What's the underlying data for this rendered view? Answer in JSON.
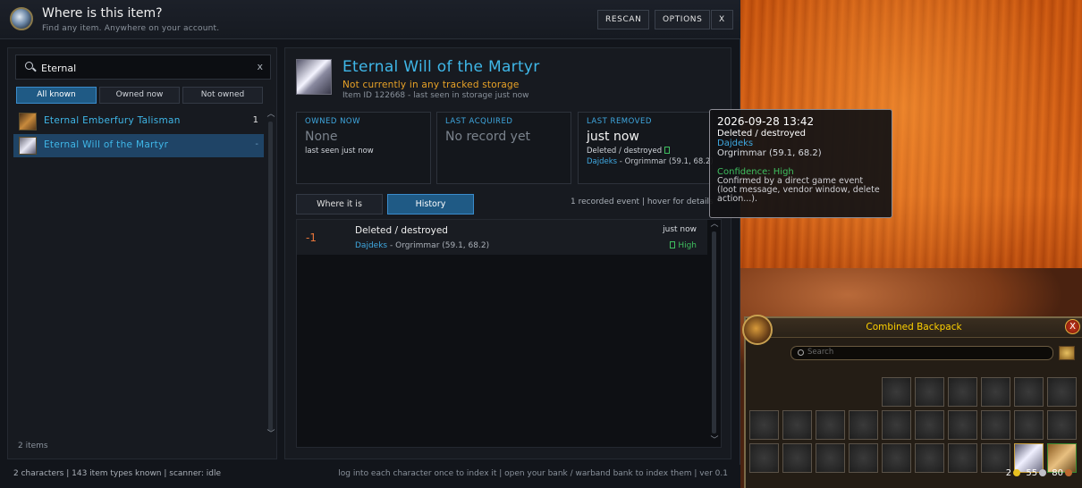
{
  "app": {
    "title": "Where is this item?",
    "subtitle": "Find any item. Anywhere on your account.",
    "buttons": {
      "rescan": "RESCAN",
      "options": "OPTIONS",
      "close": "X"
    }
  },
  "search": {
    "value": "Eternal",
    "clear": "x"
  },
  "filters": [
    "All known",
    "Owned now",
    "Not owned"
  ],
  "results": [
    {
      "name": "Eternal Emberfury Talisman",
      "count": "1"
    },
    {
      "name": "Eternal Will of the Martyr",
      "count": "-"
    }
  ],
  "results_footer": "2 items",
  "detail": {
    "title": "Eternal Will of the Martyr",
    "status": "Not currently in any tracked storage",
    "meta": "Item ID 122668  -  last seen in storage just now",
    "cards": {
      "owned": {
        "label": "OWNED NOW",
        "value": "None",
        "sub": "last seen just now"
      },
      "acquired": {
        "label": "LAST ACQUIRED",
        "value": "No record yet"
      },
      "removed": {
        "label": "LAST REMOVED",
        "value": "just now",
        "sub": "Deleted / destroyed",
        "who": "Dajdeks",
        "sep": "-",
        "where": "Orgrimmar  (59.1, 68.2)"
      }
    },
    "tabs": [
      "Where it is",
      "History"
    ],
    "events_info": "1 recorded event  |  hover for details",
    "events": [
      {
        "delta": "-1",
        "title": "Deleted / destroyed",
        "who": "Dajdeks",
        "sep": "-",
        "where": "Orgrimmar  (59.1, 68.2)",
        "time": "just now",
        "confidence": "High"
      }
    ]
  },
  "tooltip": {
    "time": "2026-09-28 13:42",
    "event": "Deleted / destroyed",
    "who": "Dajdeks",
    "where": "Orgrimmar  (59.1, 68.2)",
    "confidence": "Confidence: High",
    "desc": "Confirmed by a direct game event (loot message, vendor window, delete action...)."
  },
  "status": {
    "left": "2 characters  |  143 item types known  |  scanner: idle",
    "right": "log into each character once to index it  |  open your bank / warband bank to index them  |  ver 0.1"
  },
  "backpack": {
    "title": "Combined Backpack",
    "close": "X",
    "search_placeholder": "Search",
    "money": {
      "gold": "2",
      "silver": "55",
      "copper": "80"
    }
  },
  "colors": {
    "accent": "#3fb7e8",
    "warning": "#e8a227",
    "good": "#3fbf5f",
    "delta": "#e8753a",
    "bag_title": "#ffd100"
  },
  "icons": [
    "app-compass-icon",
    "search-icon",
    "talisman-icon",
    "martyr-icon",
    "check-icon",
    "bag-portrait-icon",
    "coin-gold-icon",
    "coin-silver-icon",
    "coin-copper-icon"
  ]
}
